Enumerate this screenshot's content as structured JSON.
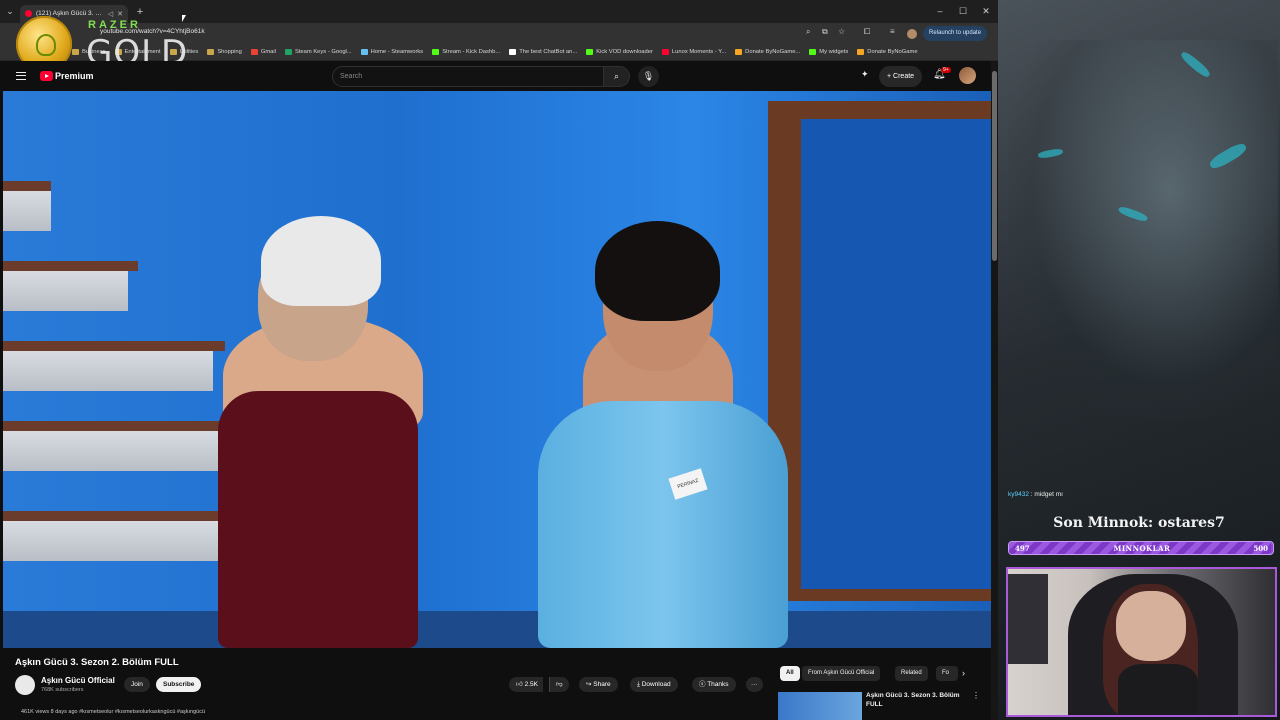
{
  "browser": {
    "tab_title": "(121) Aşkın Gücü 3. Sezon",
    "new_tab_label": "+",
    "url": "youtube.com/watch?v=4CYhtjBo61k",
    "relaunch_label": "Relaunch to update",
    "bookmarks": [
      {
        "label": "Business",
        "icon": "folder-icon",
        "color": "#c9a64a"
      },
      {
        "label": "Entertainment",
        "icon": "folder-icon",
        "color": "#c9a64a"
      },
      {
        "label": "Utilities",
        "icon": "folder-icon",
        "color": "#c9a64a"
      },
      {
        "label": "Shopping",
        "icon": "folder-icon",
        "color": "#c9a64a"
      },
      {
        "label": "Gmail",
        "icon": "gmail-icon",
        "color": "#ea4335"
      },
      {
        "label": "Steam Keys - Googl...",
        "icon": "sheets-icon",
        "color": "#1fa463"
      },
      {
        "label": "Home - Steamworks",
        "icon": "steam-icon",
        "color": "#66c0f4"
      },
      {
        "label": "Stream - Kick Dashb...",
        "icon": "kick-icon",
        "color": "#53fc18"
      },
      {
        "label": "The best ChatBot an...",
        "icon": "chatbot-icon",
        "color": "#ffffff"
      },
      {
        "label": "Kick VOD downloader",
        "icon": "kick-icon",
        "color": "#53fc18"
      },
      {
        "label": "Lunox Moments - Y...",
        "icon": "youtube-icon",
        "color": "#ff0033"
      },
      {
        "label": "Donate ByNoGame...",
        "icon": "bynogame-icon",
        "color": "#f5a623"
      },
      {
        "label": "My widgets",
        "icon": "widget-icon",
        "color": "#53fc18"
      },
      {
        "label": "Donate ByNoGame",
        "icon": "bynogame-icon",
        "color": "#f5a623"
      }
    ]
  },
  "overlay": {
    "razer_text": "RAZER",
    "gold_text": "GOLD"
  },
  "youtube": {
    "brand": "Premium",
    "search_placeholder": "Search",
    "create_label": "Create",
    "notifications_badge": "9+",
    "video_title": "Aşkın Gücü 3. Sezon 2. Bölüm FULL",
    "channel_name": "Aşkın Gücü Official",
    "subscribers": "768K subscribers",
    "join_label": "Join",
    "subscribe_label": "Subscribe",
    "likes": "2.5K",
    "share_label": "Share",
    "download_label": "Download",
    "thanks_label": "Thanks",
    "views_line": "461K views  8 days ago  #kısmetseolur #kısmetseolurkaskngücü #aşkıngücü",
    "name_tag": "PERİNAZ",
    "chips": [
      "All",
      "From Aşkın Gücü Official",
      "Related",
      "Fo"
    ],
    "recommended_title": "Aşkın Gücü 3. Sezon 3. Bölüm FULL"
  },
  "stream": {
    "chat_user": "ky9432",
    "chat_message": "midget mı",
    "last_sub": "Son Minnok: ostares7",
    "goal_current": "497",
    "goal_label": "MINNOKLAR",
    "goal_target": "500",
    "goal_progress": 0.994,
    "accent_color": "#a85ad9"
  }
}
